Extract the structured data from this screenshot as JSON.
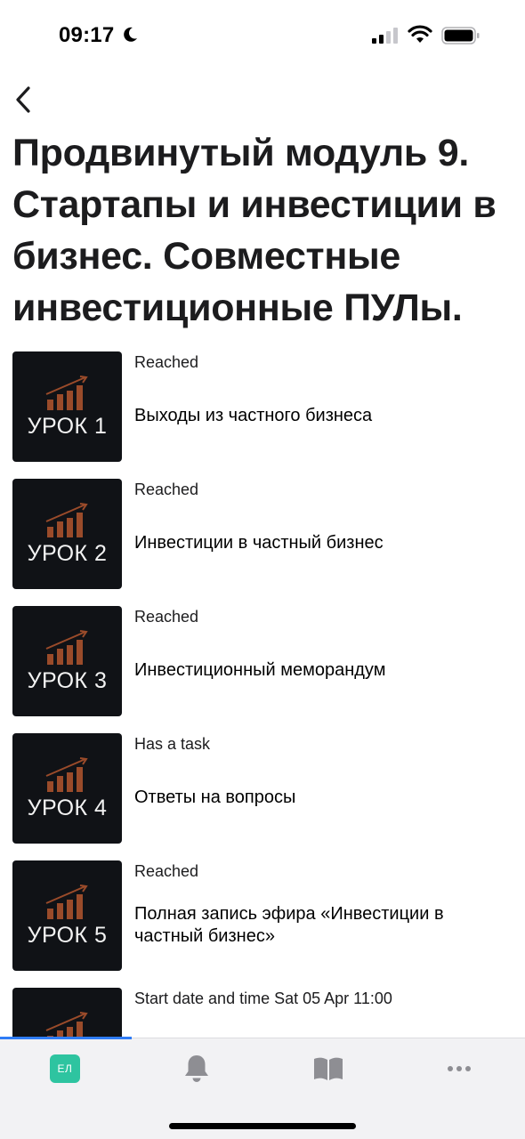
{
  "status_bar": {
    "time": "09:17"
  },
  "header": {
    "title": "Продвинутый модуль 9. Стартапы и инвестиции в бизнес. Совместные инвестиционные ПУЛы."
  },
  "lessons": [
    {
      "thumb_label": "УРОК 1",
      "status": "Reached",
      "title": "Выходы из частного бизнеса"
    },
    {
      "thumb_label": "УРОК 2",
      "status": "Reached",
      "title": "Инвестиции в частный бизнес"
    },
    {
      "thumb_label": "УРОК 3",
      "status": "Reached",
      "title": "Инвестиционный меморандум"
    },
    {
      "thumb_label": "УРОК 4",
      "status": "Has a task",
      "title": "Ответы на вопросы"
    },
    {
      "thumb_label": "УРОК 5",
      "status": "Reached",
      "title": "Полная запись эфира «Инвестиции в частный бизнес»"
    },
    {
      "thumb_label": "",
      "status": "Start date and time Sat 05 Apr 11:00",
      "title": ""
    }
  ],
  "tab_bar": {
    "avatar_initials": "ЕЛ",
    "tabs": [
      {
        "icon": "avatar-icon"
      },
      {
        "icon": "bell-icon"
      },
      {
        "icon": "book-icon"
      },
      {
        "icon": "more-icon"
      }
    ]
  },
  "colors": {
    "accent": "#2f7cf6",
    "avatar_bg": "#2ec4a0",
    "thumb_bg": "#101216",
    "chart_bars": "#9a4b2a"
  }
}
